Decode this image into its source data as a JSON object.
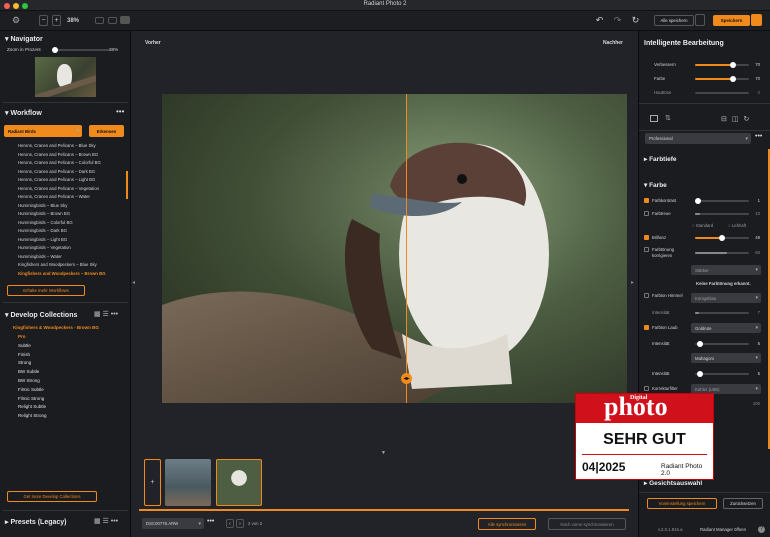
{
  "app": {
    "title": "Radiant Photo 2"
  },
  "toolbar": {
    "zoom": "38%",
    "save_all": "Alle speichern",
    "save": "Speichern"
  },
  "navigator": {
    "title": "Navigator",
    "zoom_label": "Zoom in Prozent",
    "zoom_value": "38%"
  },
  "workflow": {
    "title": "Workflow",
    "category": "Radiant Birds",
    "detect": "Erkennen",
    "items": [
      "Herons, Cranes and Pelicans – Blue Sky",
      "Herons, Cranes and Pelicans – Brown BG",
      "Herons, Cranes and Pelicans – Colorful BG",
      "Herons, Cranes and Pelicans – Dark BG",
      "Herons, Cranes and Pelicans – Light BG",
      "Herons, Cranes and Pelicans – Vegetation",
      "Herons, Cranes and Pelicans – Water",
      "Hummingbirds – Blue Sky",
      "Hummingbirds – Brown BG",
      "Hummingbirds – Colorful BG",
      "Hummingbirds – Dark BG",
      "Hummingbirds – Light BG",
      "Hummingbirds – Vegetation",
      "Hummingbirds – Water",
      "Kingfishers and Woodpeckers – Blue Sky",
      "Kingfishers and Woodpeckers – Brown BG"
    ],
    "more": "Erhalte mehr Workflows"
  },
  "develop": {
    "title": "Develop Collections",
    "group": "Kingfishers & Woodpeckers - Brown BG",
    "items": [
      "Pro",
      "Subtle",
      "Finish",
      "Strong",
      "BW Subtle",
      "BW Strong",
      "Filmic Subtle",
      "Filmic Strong",
      "Relight Subtle",
      "Relight Strong"
    ],
    "more": "Get more Develop Collections"
  },
  "presets": {
    "title": "Presets (Legacy)"
  },
  "view": {
    "before": "Vorher",
    "after": "Nachher"
  },
  "bottom": {
    "file": "DSC00776.ARW",
    "page": "2 von 2",
    "sync_all": "Alle synchronisieren",
    "sync_prev": "Nach vorne synchronisieren"
  },
  "right": {
    "title": "Intelligente Bearbeitung",
    "s1": "Verbessern",
    "v1": "70",
    "s2": "Farbe",
    "v2": "70",
    "s3": "Hauttöne",
    "v3": "0",
    "profile": "Professional",
    "farbtiefe": "Farbtiefe",
    "farbe": "Farbe",
    "kontrast": "Farbkontrast",
    "kv": "1",
    "treue": "Farbtreue",
    "tv": "10",
    "standard": "Standard",
    "lebhaft": "Lebhaft",
    "brillanz": "Brillanz",
    "bv": "49",
    "korr": "Farbtönung korrigieren",
    "korrv": "60",
    "staerker": "Stärker",
    "keine": "Keine Farbtönung erkannt.",
    "himmel": "Farbton Himmel",
    "himmel_dd": "Königsblau",
    "int": "Intensität",
    "iv1": "7",
    "laub": "Farbton Laub",
    "laub_dd": "Goldrute",
    "iv2": "5",
    "mahagoni": "Mahagoni",
    "iv3": "5",
    "filter": "Korrekturfilter",
    "filter_dd": "Kühler (LBB)",
    "fv": "100",
    "gesicht": "Gesichtsauswahl",
    "save_pref": "Voreinstellung speichern",
    "reset": "Zurücksetzen",
    "version": "v.2.0.1.816.a",
    "manager": "Radiant Manager öffnen"
  },
  "badge": {
    "brand": "Digital",
    "name": "photo",
    "rating": "SEHR GUT",
    "issue": "04|2025",
    "product": "Radiant Photo 2.0"
  }
}
